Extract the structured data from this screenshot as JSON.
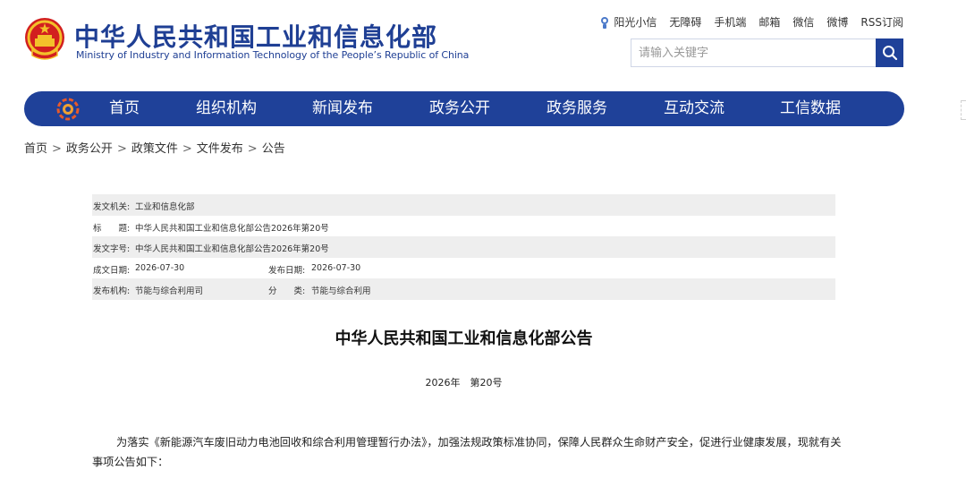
{
  "header": {
    "title_cn": "中华人民共和国工业和信息化部",
    "title_en": "Ministry of Industry and Information Technology of the People’s Republic of China",
    "emblem_icon": "national-emblem-icon",
    "top_links": [
      "阳光小信",
      "无障碍",
      "手机端",
      "邮箱",
      "微信",
      "微博",
      "RSS订阅"
    ],
    "search": {
      "placeholder": "请输入关键字",
      "button_icon": "search-icon"
    }
  },
  "nav": {
    "logo_icon": "miit-logo-icon",
    "items": [
      "首页",
      "组织机构",
      "新闻发布",
      "政务公开",
      "政务服务",
      "互动交流",
      "工信数据"
    ],
    "bg_color": "#1f4199"
  },
  "breadcrumb": {
    "items": [
      "首页",
      "政务公开",
      "政策文件",
      "文件发布",
      "公告"
    ],
    "separator": ">"
  },
  "meta": {
    "issuer_label": "发文机关:",
    "issuer": "工业和信息化部",
    "title_label": "标　　题:",
    "title": "中华人民共和国工业和信息化部公告2026年第20号",
    "docno_label": "发文字号:",
    "docno": "中华人民共和国工业和信息化部公告2026年第20号",
    "created_label": "成文日期:",
    "created": "2026-07-30",
    "published_label": "发布日期:",
    "published": "2026-07-30",
    "org_label": "发布机构:",
    "org": "节能与综合利用司",
    "category_label": "分　　类:",
    "category": "节能与综合利用"
  },
  "document": {
    "title": "中华人民共和国工业和信息化部公告",
    "number": "2026年　第20号",
    "body": "为落实《新能源汽车废旧动力电池回收和综合利用管理暂行办法》，加强法规政策标准协同，保障人民群众生命财产安全，促进行业健康发展，现就有关事项公告如下："
  },
  "colors": {
    "brand_blue": "#1f3f94",
    "nav_blue": "#1f4199",
    "meta_shade": "#eeeeee"
  }
}
